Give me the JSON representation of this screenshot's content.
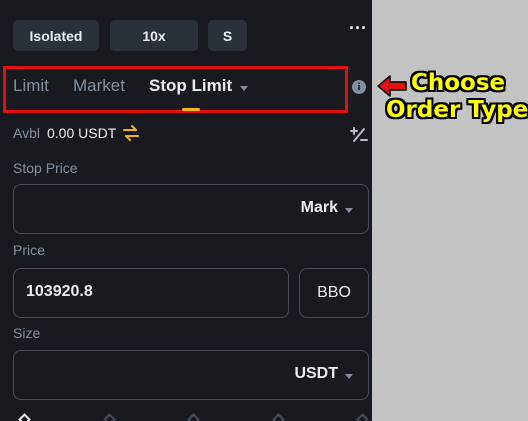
{
  "top_buttons": {
    "margin_mode": "Isolated",
    "leverage": "10x",
    "position_mode": "S"
  },
  "order_tabs": [
    {
      "label": "Limit",
      "active": false
    },
    {
      "label": "Market",
      "active": false
    },
    {
      "label": "Stop Limit",
      "active": true
    }
  ],
  "balance": {
    "label": "Avbl",
    "value": "0.00 USDT"
  },
  "stop_price": {
    "label": "Stop Price",
    "value": "",
    "trigger_type": "Mark"
  },
  "price": {
    "label": "Price",
    "value": "103920.8",
    "bbo_label": "BBO"
  },
  "size": {
    "label": "Size",
    "value": "",
    "unit": "USDT"
  },
  "annotation": {
    "line1": "Choose",
    "line2": "Order Type"
  },
  "colors": {
    "accent": "#f0b90b",
    "highlight_box": "#e01010",
    "annotation_text": "#ffff00",
    "panel_bg": "#181a20"
  },
  "icons": {
    "more": "more-dots-icon",
    "info": "info-icon",
    "swap": "swap-arrows-icon",
    "calculator": "calculator-icon"
  }
}
